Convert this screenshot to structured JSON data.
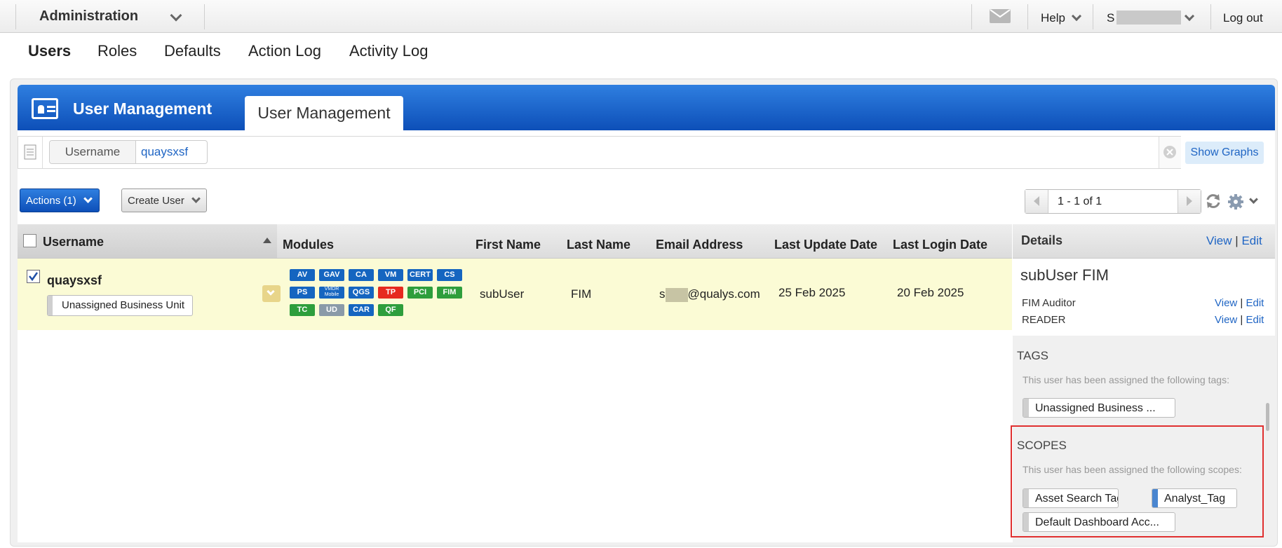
{
  "topbar": {
    "app_menu": "Administration",
    "help": "Help",
    "user": "S",
    "logout": "Log out"
  },
  "nav": {
    "items": [
      "Users",
      "Roles",
      "Defaults",
      "Action Log",
      "Activity Log"
    ],
    "active": "Users"
  },
  "header": {
    "title": "User Management",
    "tab": "User Management"
  },
  "search": {
    "field": "Username",
    "value": "quaysxsf",
    "show_graphs": "Show Graphs"
  },
  "toolbar": {
    "actions": "Actions (1)",
    "create_user": "Create User",
    "pagination": "1 - 1 of 1"
  },
  "table": {
    "columns": {
      "username": "Username",
      "modules": "Modules",
      "first_name": "First Name",
      "last_name": "Last Name",
      "email": "Email Address",
      "last_update": "Last Update Date",
      "last_login": "Last Login Date"
    },
    "row": {
      "username": "quaysxsf",
      "business_unit": "Unassigned Business Unit",
      "modules": [
        {
          "label": "AV",
          "color": "blue"
        },
        {
          "label": "GAV",
          "color": "blue"
        },
        {
          "label": "CA",
          "color": "blue"
        },
        {
          "label": "VM",
          "color": "blue"
        },
        {
          "label": "CERT",
          "color": "blue"
        },
        {
          "label": "CS",
          "color": "blue"
        },
        {
          "label": "PS",
          "color": "blue"
        },
        {
          "label": "VMDR Mobile",
          "color": "blue"
        },
        {
          "label": "QGS",
          "color": "blue"
        },
        {
          "label": "TP",
          "color": "red"
        },
        {
          "label": "PCI",
          "color": "green"
        },
        {
          "label": "FIM",
          "color": "green"
        },
        {
          "label": "TC",
          "color": "green"
        },
        {
          "label": "UD",
          "color": "gray"
        },
        {
          "label": "CAR",
          "color": "blue"
        },
        {
          "label": "QF",
          "color": "green"
        }
      ],
      "first_name": "subUser",
      "last_name": "FIM",
      "email_prefix": "s",
      "email_suffix": "@qualys.com",
      "last_update": "25 Feb 2025",
      "last_login": "20 Feb 2025"
    }
  },
  "details": {
    "heading": "Details",
    "view": "View",
    "edit": "Edit",
    "name": "subUser FIM",
    "roles": [
      "FIM Auditor",
      "READER"
    ],
    "tags_title": "TAGS",
    "tags_desc": "This user has been assigned the following tags:",
    "tags": [
      "Unassigned Business ..."
    ],
    "scopes_title": "SCOPES",
    "scopes_desc": "This user has been assigned the following scopes:",
    "scopes": [
      "Asset Search Tags",
      "Analyst_Tag",
      "Default Dashboard Acc..."
    ]
  },
  "colors": {
    "header_blue": "#0d4fb8",
    "row_highlight": "#fbfbd5",
    "scope_highlight": "#e03030",
    "link": "#1f65c4"
  }
}
